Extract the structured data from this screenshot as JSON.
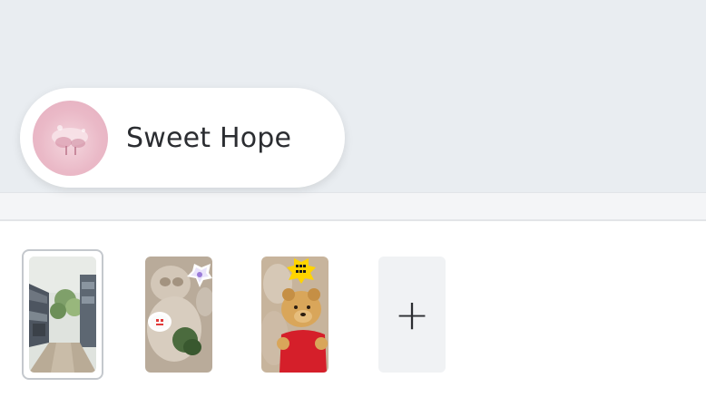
{
  "profile": {
    "name": "Sweet Hope",
    "avatar_color": "#eab9c7"
  },
  "stories": [
    {
      "id": "story-1",
      "selected": true,
      "icon": "street-photo"
    },
    {
      "id": "story-2",
      "selected": false,
      "icon": "plush-photo"
    },
    {
      "id": "story-3",
      "selected": false,
      "icon": "bear-photo"
    }
  ],
  "add_button": {
    "label": "+"
  },
  "colors": {
    "background_top": "#e9edf1",
    "pill": "#ffffff",
    "add_button_bg": "#f0f2f4",
    "selected_border": "#c4c8cd"
  }
}
